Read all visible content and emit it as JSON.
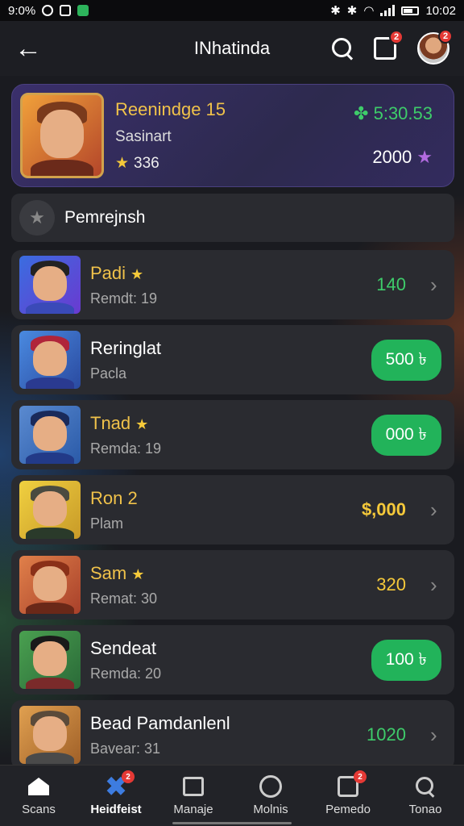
{
  "status_bar": {
    "time_left": "9:0%",
    "time_right": "10:02"
  },
  "header": {
    "title": "INhatinda",
    "notif_badge": "2",
    "avatar_badge": "2"
  },
  "featured": {
    "name": "Reenindge 15",
    "subtitle": "Sasinart",
    "stars": "336",
    "cash": "5:30.53",
    "gems": "2000"
  },
  "section": {
    "label": "Pemrejnsh"
  },
  "rows": [
    {
      "name": "Padi",
      "starred": true,
      "sub": "Remdt: 19",
      "value": "140",
      "style": "green-text",
      "chevron": true
    },
    {
      "name": "Reringlat",
      "starred": false,
      "sub": "Pacla",
      "value": "500 ৳",
      "style": "pill",
      "chevron": false
    },
    {
      "name": "Tnad",
      "starred": true,
      "sub": "Remda: 19",
      "value": "000 ৳",
      "style": "pill",
      "chevron": false
    },
    {
      "name": "Ron 2",
      "starred": false,
      "sub": "Plam",
      "value": "$,000",
      "style": "gold-text",
      "chevron": true
    },
    {
      "name": "Sam",
      "starred": true,
      "sub": "Remat: 30",
      "value": "320",
      "style": "gold-plain",
      "chevron": true
    },
    {
      "name": "Sendeat",
      "starred": false,
      "sub": "Remda: 20",
      "value": "100 ৳",
      "style": "pill",
      "chevron": false
    },
    {
      "name": "Bead Pamdanlenl",
      "starred": false,
      "sub": "Bavear: 31",
      "value": "1020",
      "style": "green-text",
      "chevron": true
    }
  ],
  "bottom_nav": [
    {
      "label": "Scans",
      "icon": "home-icon"
    },
    {
      "label": "Heidfeist",
      "icon": "x-icon",
      "badge": "2",
      "active": true
    },
    {
      "label": "Manaje",
      "icon": "inbox-icon"
    },
    {
      "label": "Molnis",
      "icon": "smile-icon"
    },
    {
      "label": "Pemedo",
      "icon": "edit-icon",
      "badge": "2"
    },
    {
      "label": "Tonao",
      "icon": "search-icon"
    }
  ],
  "colors": {
    "accent_green": "#22b35a",
    "gold": "#f0c24a",
    "badge_red": "#e53935",
    "background": "#1c1d22"
  }
}
